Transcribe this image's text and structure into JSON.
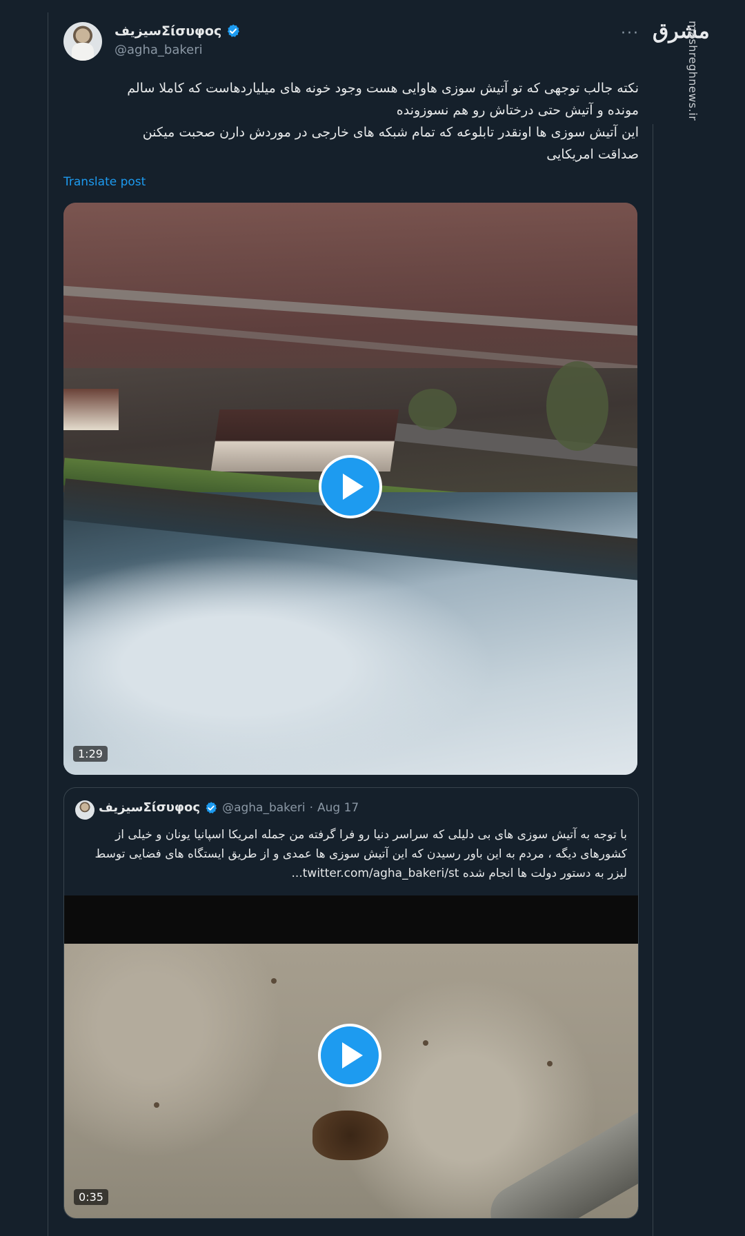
{
  "watermark": {
    "logo_text": "مشرق",
    "site_text": "mashreghnews.ir"
  },
  "post": {
    "author": {
      "display_name": "سیزیفΣίσυφος",
      "handle": "@agha_bakeri",
      "verified_icon": "verified-badge-icon",
      "accent_color": "#1d9bf0"
    },
    "more_label": "···",
    "text_lines": [
      "نکته جالب توجهی که تو آتیش سوزی هاوایی هست وجود خونه های میلیاردهاست که کاملا سالم",
      "مونده و آتیش حتی درختاش رو هم نسوزونده",
      "این آتیش سوزی ها اونقدر تابلوعه که تمام شبکه های خارجی در موردش دارن صحبت میکنن",
      "صداقت امریکایی"
    ],
    "translate_label": "Translate post",
    "video": {
      "duration": "1:29",
      "play_icon": "play-icon"
    }
  },
  "quoted_post": {
    "author": {
      "display_name": "سیزیفΣίσυφος",
      "handle": "@agha_bakeri",
      "separator": "·",
      "date": "Aug 17"
    },
    "text_lines": [
      "با توجه به آتیش سوزی های بی دلیلی که سراسر دنیا رو فرا گرفته من جمله امریکا اسپانیا یونان و خیلی از",
      "کشورهای دیگه ، مردم به این باور رسیدن که این آتیش سوزی ها عمدی و از طریق ایستگاه های فضایی توسط",
      "لیزر به دستور دولت ها انجام شده  twitter.com/agha_bakeri/st..."
    ],
    "video": {
      "duration": "0:35",
      "play_icon": "play-icon"
    }
  }
}
